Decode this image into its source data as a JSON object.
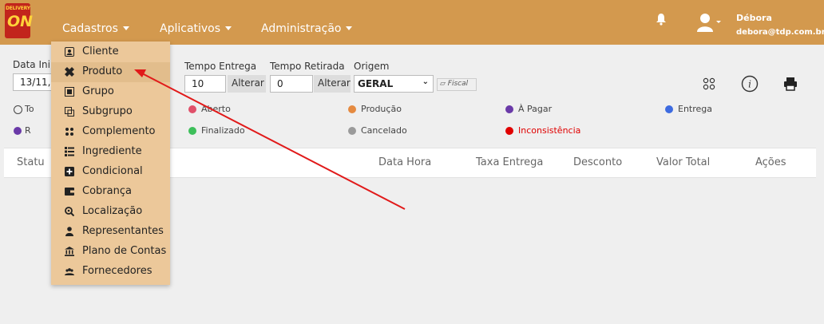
{
  "brand": {
    "logo_top": "DELIVERY",
    "logo_main": "ON"
  },
  "nav": {
    "cadastros": "Cadastros",
    "aplicativos": "Aplicativos",
    "administracao": "Administração"
  },
  "user": {
    "name": "Débora",
    "email": "debora@tdp.com.br"
  },
  "filters": {
    "data_inicio_label": "Data Ini",
    "data_inicio_value": "13/11,",
    "tempo_entrega_label": "Tempo Entrega",
    "tempo_entrega_value": "10",
    "tempo_retirada_label": "Tempo Retirada",
    "tempo_retirada_value": "0",
    "alterar_label": "Alterar",
    "origem_label": "Origem",
    "origem_value": "GERAL",
    "fiscal_label": "Fiscal"
  },
  "legend": {
    "partial_row1": "To",
    "partial_row2": "R",
    "items": [
      {
        "label": "Aberto",
        "color": "#e0506a"
      },
      {
        "label": "Finalizado",
        "color": "#3dbf5a"
      },
      {
        "label": "Produção",
        "color": "#e58a40"
      },
      {
        "label": "Cancelado",
        "color": "#9a9a9a"
      },
      {
        "label": "À Pagar",
        "color": "#6a3aa8"
      },
      {
        "label": "Inconsistência",
        "color": "#e00000"
      },
      {
        "label": "Entrega",
        "color": "#3d6be0"
      }
    ]
  },
  "table": {
    "headers": {
      "status": "Statu",
      "data_hora": "Data Hora",
      "taxa_entrega": "Taxa Entrega",
      "desconto": "Desconto",
      "valor_total": "Valor Total",
      "acoes": "Ações"
    }
  },
  "dropdown": {
    "items": [
      {
        "label": "Cliente",
        "icon": "user-card-icon"
      },
      {
        "label": "Produto",
        "icon": "boxes-icon"
      },
      {
        "label": "Grupo",
        "icon": "grid-group-icon"
      },
      {
        "label": "Subgrupo",
        "icon": "subgroup-icon"
      },
      {
        "label": "Complemento",
        "icon": "dots-icon"
      },
      {
        "label": "Ingrediente",
        "icon": "list-icon"
      },
      {
        "label": "Condicional",
        "icon": "plus-square-icon"
      },
      {
        "label": "Cobrança",
        "icon": "wallet-icon"
      },
      {
        "label": "Localização",
        "icon": "location-search-icon"
      },
      {
        "label": "Representantes",
        "icon": "person-icon"
      },
      {
        "label": "Plano de Contas",
        "icon": "bank-icon"
      },
      {
        "label": "Fornecedores",
        "icon": "people-icon"
      }
    ],
    "hovered_index": 1
  },
  "colors": {
    "topbar": "#d3994e",
    "dropdown": "#ecc89a",
    "arrow": "#e11a1a"
  }
}
